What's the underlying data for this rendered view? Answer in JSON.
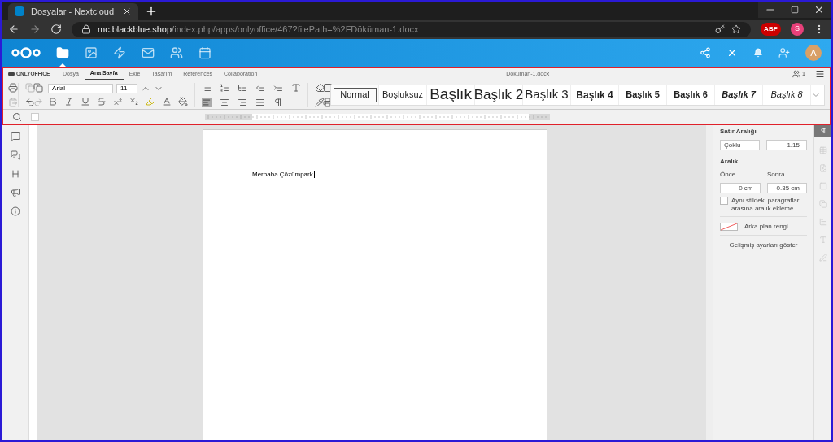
{
  "browser": {
    "tab_title": "Dosyalar - Nextcloud",
    "url_host": "mc.blackblue.shop",
    "url_path": "/index.php/apps/onlyoffice/467?filePath=%2FDöküman-1.docx",
    "extension_badge": "ABP",
    "profile_initial": "S"
  },
  "nextcloud": {
    "apps": [
      {
        "kind": "files",
        "selected": true
      },
      {
        "kind": "photos",
        "selected": false
      },
      {
        "kind": "activity",
        "selected": false
      },
      {
        "kind": "mail",
        "selected": false
      },
      {
        "kind": "contacts",
        "selected": false
      },
      {
        "kind": "calendar",
        "selected": false
      }
    ],
    "avatar_initial": "A"
  },
  "editor": {
    "brand": "ONLYOFFICE",
    "tabs": [
      {
        "label": "Dosya",
        "selected": false
      },
      {
        "label": "Ana Sayfa",
        "selected": true
      },
      {
        "label": "Ekle",
        "selected": false
      },
      {
        "label": "Tasarım",
        "selected": false
      },
      {
        "label": "References",
        "selected": false
      },
      {
        "label": "Collaboration",
        "selected": false
      }
    ],
    "document_title": "Döküman-1.docx",
    "users_count": "1",
    "font_name": "Arial",
    "font_size": "11",
    "styles": [
      {
        "label": "Normal",
        "selected": true
      },
      {
        "label": "Boşluksuz",
        "selected": false
      },
      {
        "label": "Başlık",
        "selected": false
      },
      {
        "label": "Başlık 2",
        "selected": false
      },
      {
        "label": "Başlık 3",
        "selected": false
      },
      {
        "label": "Başlık 4",
        "selected": false
      },
      {
        "label": "Başlık 5",
        "selected": false
      },
      {
        "label": "Başlık 6",
        "selected": false
      },
      {
        "label": "Başlık 7",
        "selected": false
      },
      {
        "label": "Başlık 8",
        "selected": false
      }
    ],
    "document_text": "Merhaba Çözümpark"
  },
  "paragraph_panel": {
    "line_spacing_label": "Satır Aralığı",
    "line_spacing_mode": "Çoklu",
    "line_spacing_value": "1.15",
    "spacing_label": "Aralık",
    "before_label": "Önce",
    "before_value": "0 cm",
    "after_label": "Sonra",
    "after_value": "0.35 cm",
    "same_style_checkbox": {
      "label": "Aynı stildeki paragraflar arasına aralık ekleme",
      "checked": false
    },
    "background_label": "Arka plan rengi",
    "advanced_link": "Gelişmiş ayarları göster"
  }
}
